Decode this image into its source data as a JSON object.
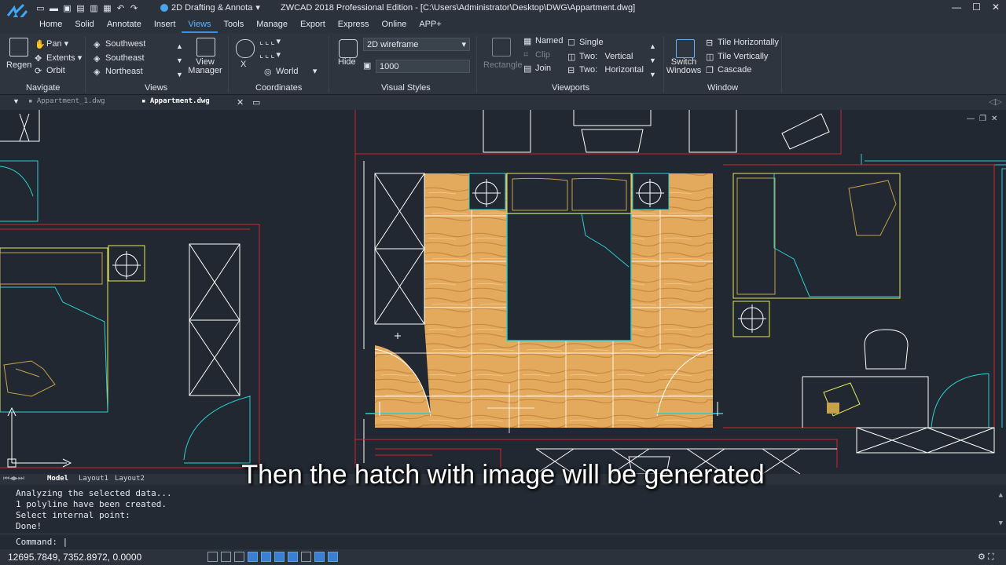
{
  "titlebar": {
    "workspace": "2D Drafting & Annota",
    "title": "ZWCAD 2018 Professional Edition - [C:\\Users\\Administrator\\Desktop\\DWG\\Appartment.dwg]"
  },
  "menu": {
    "items": [
      "Home",
      "Solid",
      "Annotate",
      "Insert",
      "Views",
      "Tools",
      "Manage",
      "Export",
      "Express",
      "Online",
      "APP+"
    ],
    "active": "Views"
  },
  "ribbon": {
    "navigate": {
      "regen": "Regen",
      "pan": "Pan",
      "extents": "Extents",
      "orbit": "Orbit",
      "label": "Navigate"
    },
    "views": {
      "items": [
        "Southwest",
        "Southeast",
        "Northeast"
      ],
      "view_manager": "View Manager",
      "label": "Views"
    },
    "coordinates": {
      "world": "World",
      "label": "Coordinates"
    },
    "visual_styles": {
      "hide": "Hide",
      "style": "2D wireframe",
      "value": "1000",
      "label": "Visual Styles"
    },
    "viewports": {
      "rectangle": "Rectangle",
      "named": "Named",
      "clip": "Clip",
      "join": "Join",
      "single": "Single",
      "two_vertical_a": "Two:",
      "two_vertical_b": "Vertical",
      "two_horizontal_a": "Two:",
      "two_horizontal_b": "Horizontal",
      "label": "Viewports"
    },
    "window": {
      "switch": "Switch Windows",
      "tile_h": "Tile Horizontally",
      "tile_v": "Tile Vertically",
      "cascade": "Cascade",
      "label": "Window"
    }
  },
  "tabs": {
    "doc1": "Appartment_1.dwg",
    "doc2": "Appartment.dwg"
  },
  "layout_tabs": [
    "Model",
    "Layout1",
    "Layout2"
  ],
  "command": {
    "history": [
      "Analyzing the selected data...",
      "1 polyline have been created.",
      "Select internal point:",
      "Done!"
    ],
    "prompt": "Command:"
  },
  "status": {
    "coords": "12695.7849, 7352.8972, 0.0000"
  },
  "subtitle": "Then the hatch with image will be generated",
  "colors": {
    "accent": "#3b8ee0",
    "wall": "#d1262c",
    "furniture": "#e8e85a",
    "cyan": "#2ad0d0",
    "wood": "#e2a75a"
  }
}
